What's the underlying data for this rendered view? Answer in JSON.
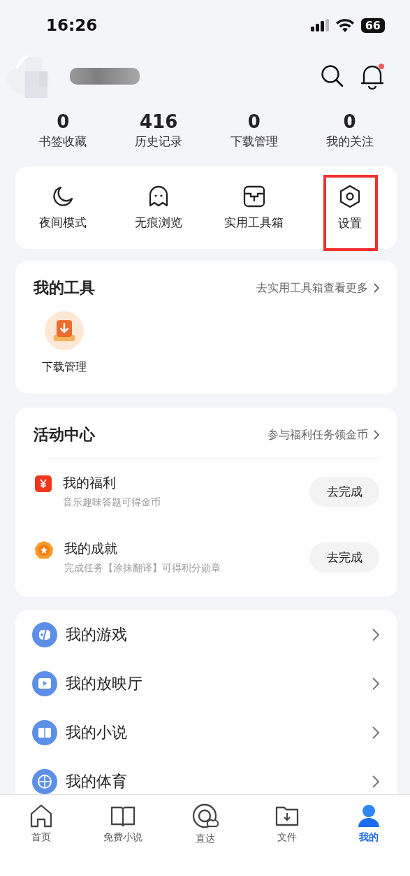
{
  "status_bar": {
    "time": "16:26",
    "battery": "66"
  },
  "header": {
    "notification_dot": true
  },
  "stats": [
    {
      "value": "0",
      "label": "书签收藏"
    },
    {
      "value": "416",
      "label": "历史记录"
    },
    {
      "value": "0",
      "label": "下载管理"
    },
    {
      "value": "0",
      "label": "我的关注"
    }
  ],
  "quick_actions": [
    {
      "label": "夜间模式",
      "highlighted": false
    },
    {
      "label": "无痕浏览",
      "highlighted": false
    },
    {
      "label": "实用工具箱",
      "highlighted": false
    },
    {
      "label": "设置",
      "highlighted": true
    }
  ],
  "my_tools": {
    "title": "我的工具",
    "link": "去实用工具箱查看更多",
    "items": [
      {
        "label": "下载管理"
      }
    ]
  },
  "activity": {
    "title": "活动中心",
    "link": "参与福利任务领金币",
    "items": [
      {
        "title": "我的福利",
        "subtitle": "音乐趣味答题可得金币",
        "button": "去完成"
      },
      {
        "title": "我的成就",
        "subtitle": "完成任务【涂抹翻译】可得积分勋章",
        "button": "去完成"
      }
    ]
  },
  "menu": [
    {
      "label": "我的游戏"
    },
    {
      "label": "我的放映厅"
    },
    {
      "label": "我的小说"
    },
    {
      "label": "我的体育"
    }
  ],
  "tab_bar": [
    {
      "label": "首页",
      "selected": false
    },
    {
      "label": "免费小说",
      "selected": false
    },
    {
      "label": "直达",
      "selected": false
    },
    {
      "label": "文件",
      "selected": false
    },
    {
      "label": "我的",
      "selected": true
    }
  ]
}
